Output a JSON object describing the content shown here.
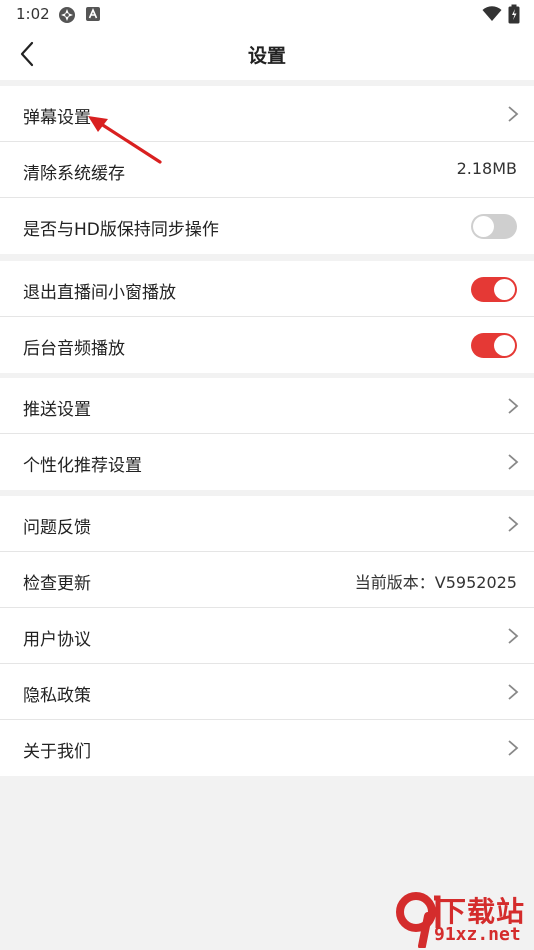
{
  "status_bar": {
    "time": "1:02"
  },
  "header": {
    "title": "设置"
  },
  "groups": [
    {
      "rows": [
        {
          "label": "弹幕设置",
          "kind": "nav"
        },
        {
          "label": "清除系统缓存",
          "kind": "value",
          "value": "2.18MB"
        },
        {
          "label": "是否与HD版保持同步操作",
          "kind": "toggle",
          "on": false
        }
      ]
    },
    {
      "rows": [
        {
          "label": "退出直播间小窗播放",
          "kind": "toggle",
          "on": true
        },
        {
          "label": "后台音频播放",
          "kind": "toggle",
          "on": true
        }
      ]
    },
    {
      "rows": [
        {
          "label": "推送设置",
          "kind": "nav"
        },
        {
          "label": "个性化推荐设置",
          "kind": "nav"
        }
      ]
    },
    {
      "rows": [
        {
          "label": "问题反馈",
          "kind": "nav"
        },
        {
          "label": "检查更新",
          "kind": "value",
          "value": "当前版本：V5952025"
        },
        {
          "label": "用户协议",
          "kind": "nav"
        },
        {
          "label": "隐私政策",
          "kind": "nav"
        },
        {
          "label": "关于我们",
          "kind": "nav"
        }
      ]
    }
  ],
  "watermark": {
    "name": "下载站",
    "site": "91xz.net"
  },
  "colors": {
    "accent": "#e53935",
    "toggle_off": "#cfcfcf",
    "divider": "#e5e5e5",
    "background": "#f2f2f2"
  }
}
